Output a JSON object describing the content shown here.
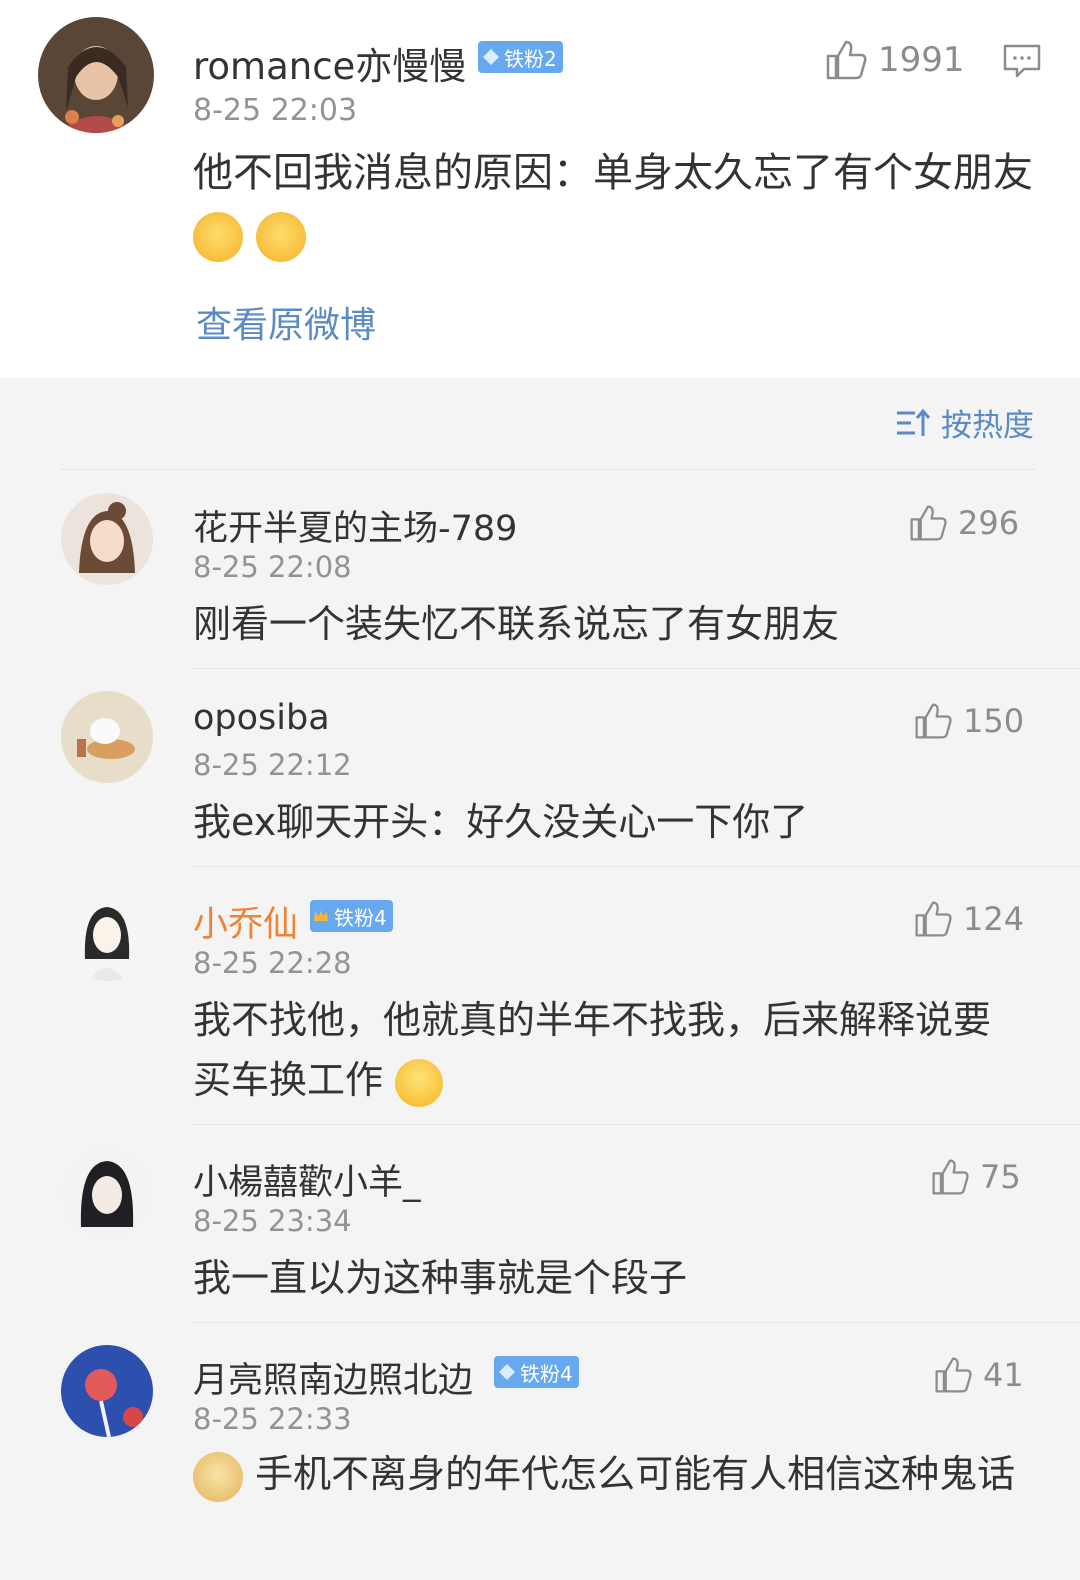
{
  "main_post": {
    "user": "romance亦慢慢",
    "badge": "铁粉2",
    "time": "8-25 22:03",
    "text": "他不回我消息的原因：单身太久忘了有个女朋友",
    "likes": "1991",
    "view_original": "查看原微博"
  },
  "sort": {
    "label": "按热度"
  },
  "comments": [
    {
      "user": "花开半夏的主场-789",
      "time": "8-25 22:08",
      "text": "刚看一个装失忆不联系说忘了有女朋友",
      "likes": "296"
    },
    {
      "user": "oposiba",
      "time": "8-25 22:12",
      "text": "我ex聊天开头：好久没关心一下你了",
      "likes": "150"
    },
    {
      "user": "小乔仙",
      "badge": "铁粉4",
      "time": "8-25 22:28",
      "text": "我不找他，他就真的半年不找我，后来解释说要买车换工作",
      "likes": "124"
    },
    {
      "user": "小楊囍歡小羊_",
      "time": "8-25 23:34",
      "text": "我一直以为这种事就是个段子",
      "likes": "75"
    },
    {
      "user": "月亮照南边照北边",
      "badge": "铁粉4",
      "time": "8-25 22:33",
      "text": "手机不离身的年代怎么可能有人相信这种鬼话",
      "likes": "41"
    }
  ],
  "colors": {
    "link": "#5b8ac5",
    "badge": "#67a8f1",
    "vip_name": "#f08236"
  }
}
